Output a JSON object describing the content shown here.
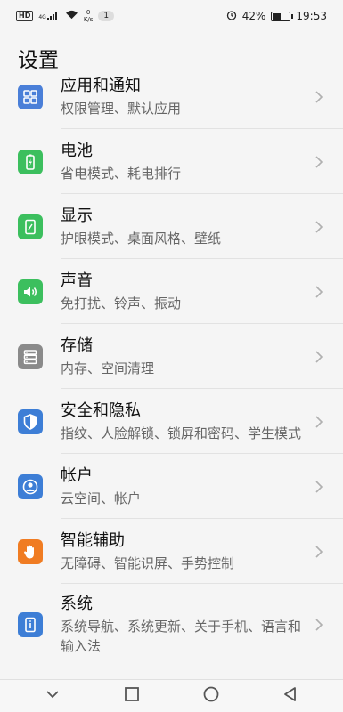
{
  "status_bar": {
    "hd": "HD",
    "network_type": "4G",
    "speed_value": "0",
    "speed_unit": "K/s",
    "notification_count": "1",
    "battery_percent": "42%",
    "time": "19:53"
  },
  "page_title": "设置",
  "items": [
    {
      "title": "应用和通知",
      "subtitle": "权限管理、默认应用",
      "icon": "apps-icon",
      "color": "#4a7fd8"
    },
    {
      "title": "电池",
      "subtitle": "省电模式、耗电排行",
      "icon": "battery-icon",
      "color": "#3cbf5e"
    },
    {
      "title": "显示",
      "subtitle": "护眼模式、桌面风格、壁纸",
      "icon": "display-icon",
      "color": "#3cbf5e"
    },
    {
      "title": "声音",
      "subtitle": "免打扰、铃声、振动",
      "icon": "sound-icon",
      "color": "#3cbf5e"
    },
    {
      "title": "存储",
      "subtitle": "内存、空间清理",
      "icon": "storage-icon",
      "color": "#8a8a8a"
    },
    {
      "title": "安全和隐私",
      "subtitle": "指纹、人脸解锁、锁屏和密码、学生模式",
      "icon": "shield-icon",
      "color": "#3d7ed6"
    },
    {
      "title": "帐户",
      "subtitle": "云空间、帐户",
      "icon": "account-icon",
      "color": "#3d7ed6"
    },
    {
      "title": "智能辅助",
      "subtitle": "无障碍、智能识屏、手势控制",
      "icon": "hand-icon",
      "color": "#f07c22"
    },
    {
      "title": "系统",
      "subtitle": "系统导航、系统更新、关于手机、语言和输入法",
      "icon": "info-icon",
      "color": "#3d7ed6"
    }
  ],
  "nav": {
    "back": "back-icon",
    "home": "home-icon",
    "recents": "recents-icon",
    "collapse": "collapse-icon"
  }
}
